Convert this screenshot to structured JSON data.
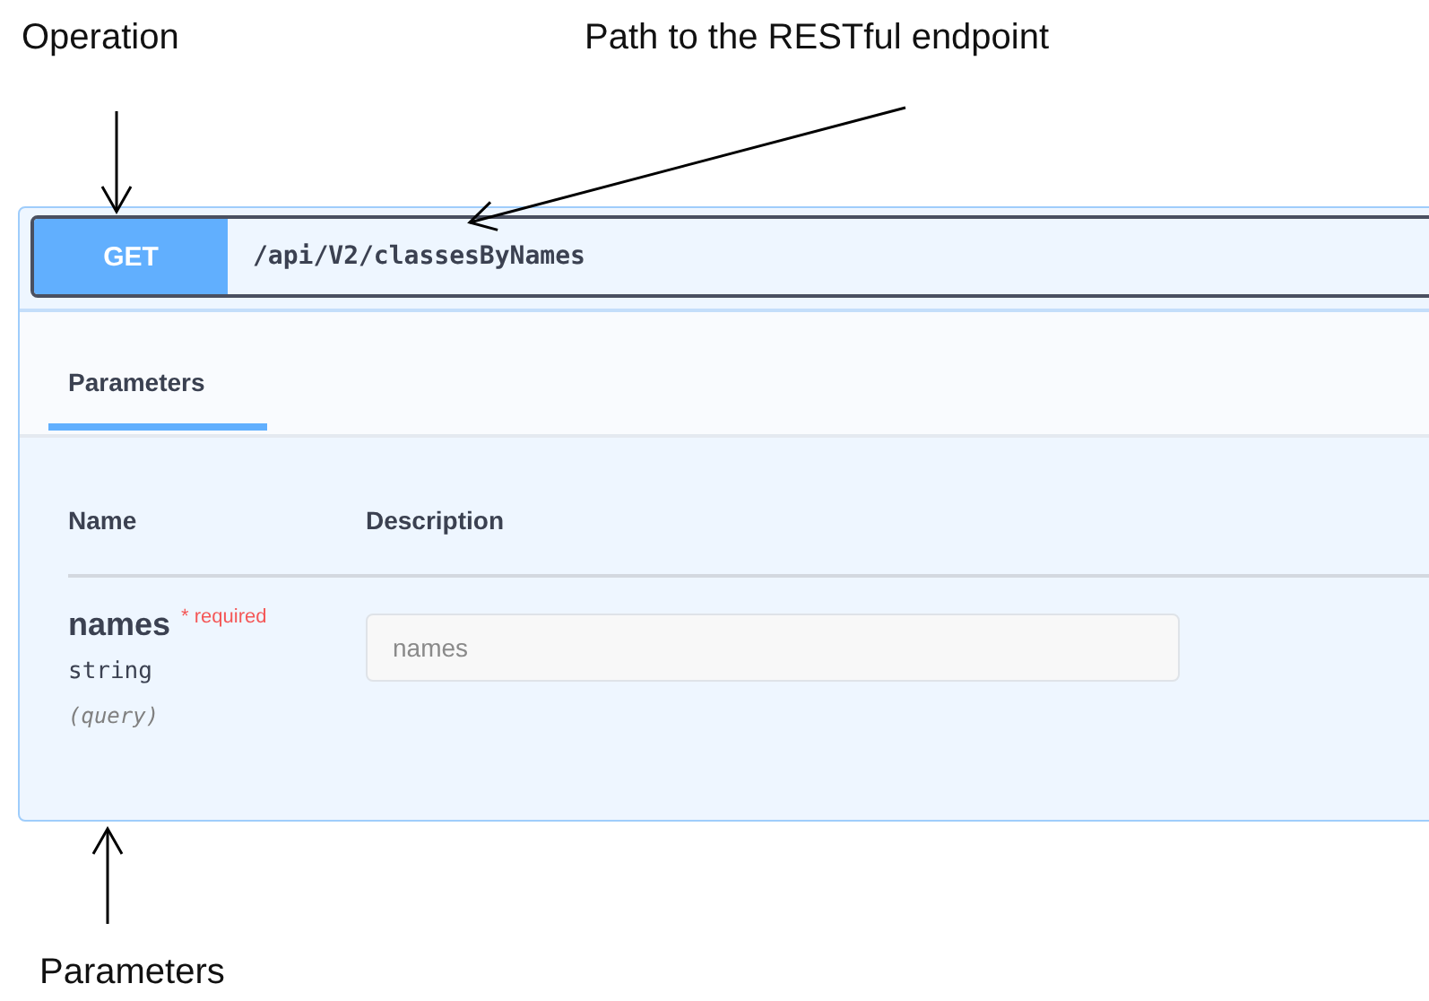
{
  "annotations": [
    {
      "text": "Operation"
    },
    {
      "text": "Path to the RESTful endpoint"
    },
    {
      "text": "Parameters"
    }
  ],
  "operation": {
    "method": "GET",
    "path": "/api/V2/classesByNames"
  },
  "tabs": [
    {
      "label": "Parameters",
      "selected": true
    }
  ],
  "table": {
    "columns": [
      "Name",
      "Description"
    ],
    "rows": [
      {
        "name": "names",
        "required": "* required",
        "type": "string",
        "location": "(query)",
        "placeholder": "names"
      }
    ]
  }
}
